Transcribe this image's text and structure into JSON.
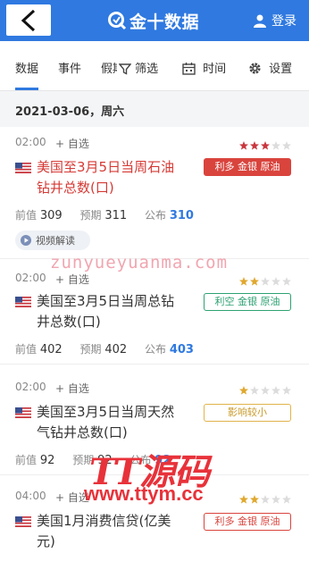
{
  "header": {
    "logo_text": "金十数据",
    "login_label": "登录",
    "brand_color": "#2f79e0"
  },
  "tabs": [
    {
      "label": "数据"
    },
    {
      "label": "事件"
    },
    {
      "label": "假期"
    },
    {
      "label": "筛选"
    },
    {
      "label": "时间"
    },
    {
      "label": "设置"
    }
  ],
  "date_header": "2021-03-06，周六",
  "events": [
    {
      "time": "02:00",
      "add_label": "+ 自选",
      "stars": 3,
      "title": "美国至3月5日当周石油钻井总数(口)",
      "tag": "利多 金银 原油",
      "prev_label": "前值",
      "prev": "309",
      "expect_label": "预期",
      "expect": "311",
      "pub_label": "公布",
      "pub": "310",
      "video_label": "视频解读"
    },
    {
      "time": "02:00",
      "add_label": "+ 自选",
      "stars": 2,
      "title": "美国至3月5日当周总钻井总数(口)",
      "tag": "利空 金银 原油",
      "prev_label": "前值",
      "prev": "402",
      "expect_label": "预期",
      "expect": "402",
      "pub_label": "公布",
      "pub": "403"
    },
    {
      "time": "02:00",
      "add_label": "+ 自选",
      "stars": 1,
      "title": "美国至3月5日当周天然气钻井总数(口)",
      "tag": "影响较小",
      "prev_label": "前值",
      "prev": "92",
      "expect_label": "预期",
      "expect": "92",
      "pub_label": "公布",
      "pub": "92"
    },
    {
      "time": "04:00",
      "add_label": "+ 自选",
      "stars": 2,
      "title": "美国1月消费信贷(亿美元)",
      "tag": "利多 金银 原油"
    }
  ],
  "watermarks": {
    "site": "zunyueyuanma.com",
    "brand": "TT源码",
    "url": "www.ttym.cc"
  }
}
